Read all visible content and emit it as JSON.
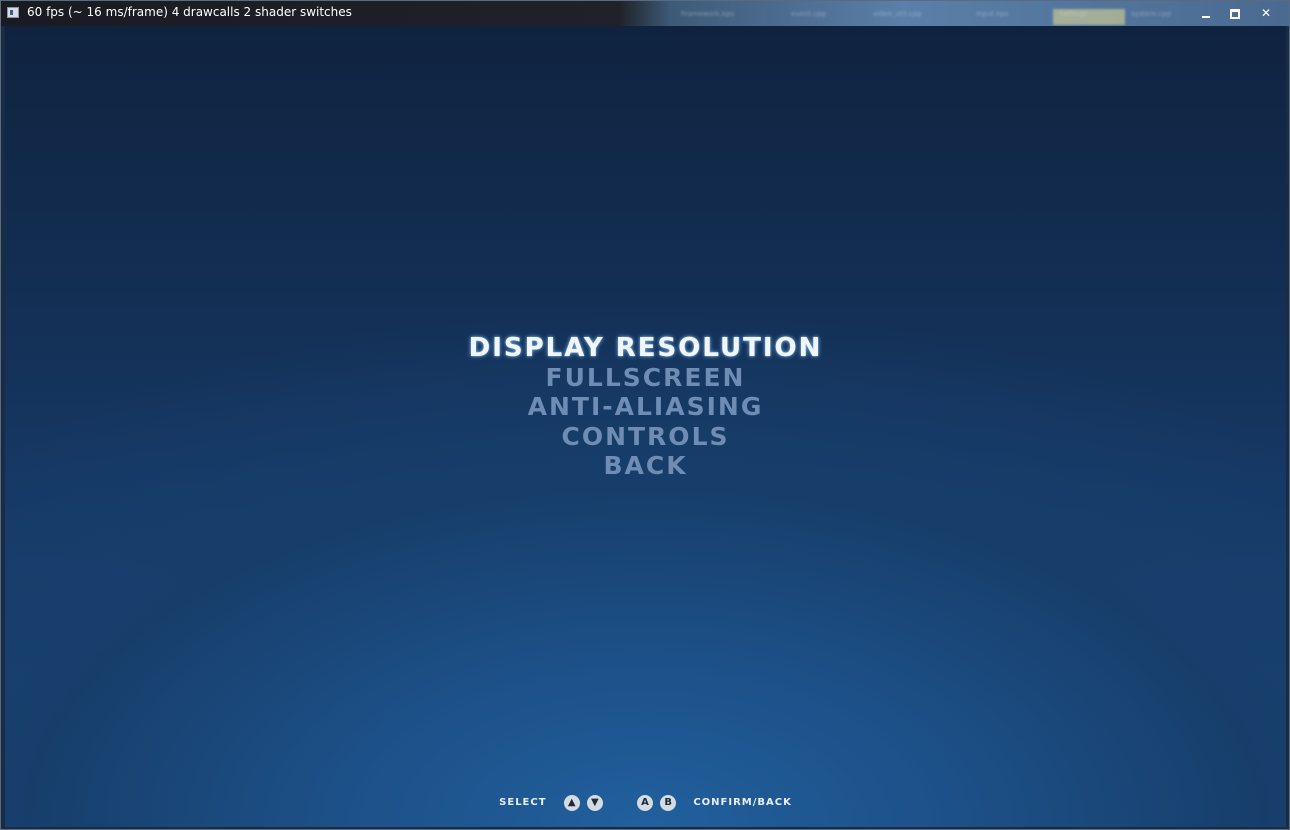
{
  "window": {
    "title": "60 fps (~ 16 ms/frame) 4 drawcalls 2 shader switches",
    "controls": {
      "minimize_name": "minimize",
      "maximize_name": "maximize",
      "close_glyph": "✕"
    },
    "background_taskbar": {
      "tab1": "Framework.kps",
      "tab2": "event.cpp",
      "tab3": "video_util.cpp",
      "tab4": "input.kps",
      "tab5": "Settings",
      "tab6": "system.cpp"
    }
  },
  "menu": {
    "items": [
      {
        "label": "DISPLAY RESOLUTION",
        "selected": true
      },
      {
        "label": "FULLSCREEN",
        "selected": false
      },
      {
        "label": "ANTI-ALIASING",
        "selected": false
      },
      {
        "label": "CONTROLS",
        "selected": false
      },
      {
        "label": "BACK",
        "selected": false
      }
    ],
    "selected_color": "#f2f6fb",
    "normal_color": "#6f8cb4"
  },
  "hints": {
    "select_label": "SELECT",
    "up_glyph": "▲",
    "down_glyph": "▼",
    "a_glyph": "A",
    "b_glyph": "B",
    "confirm_label": "CONFIRM/BACK"
  },
  "colors": {
    "background_top": "#0f233f",
    "background_bottom": "#21609e"
  }
}
